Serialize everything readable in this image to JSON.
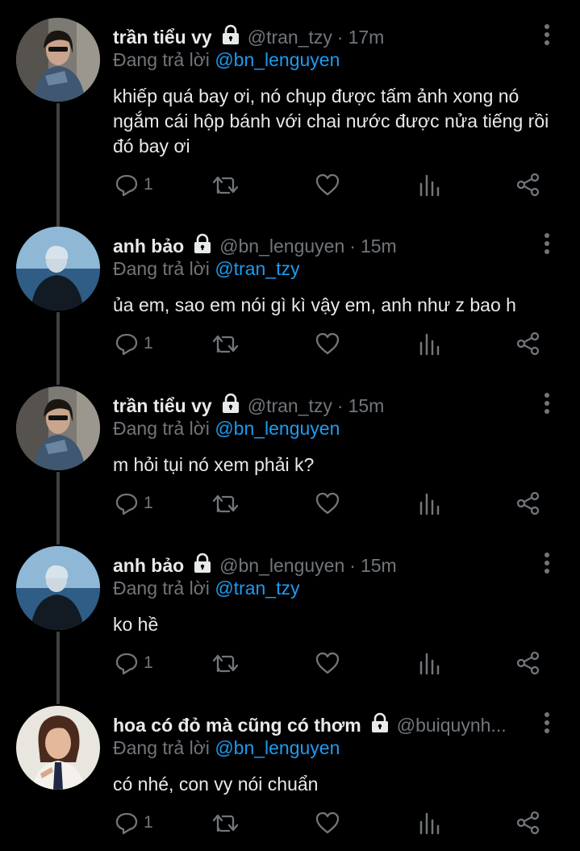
{
  "tweets": [
    {
      "name": "trần tiểu vy",
      "handle": "@tran_tzy",
      "time": "17m",
      "reply_prefix": "Đang trả lời",
      "reply_to": "@bn_lenguyen",
      "text": "khiếp quá bay ơi, nó chụp được tấm ảnh xong nó ngắm cái hộp bánh với chai nước được nửa tiếng rồi đó bay ơi",
      "reply_count": "1"
    },
    {
      "name": "anh bảo",
      "handle": "@bn_lenguyen",
      "time": "15m",
      "reply_prefix": "Đang trả lời",
      "reply_to": "@tran_tzy",
      "text": "ủa em, sao em nói gì kì vậy em, anh như z bao h",
      "reply_count": "1"
    },
    {
      "name": "trần tiểu vy",
      "handle": "@tran_tzy",
      "time": "15m",
      "reply_prefix": "Đang trả lời",
      "reply_to": "@bn_lenguyen",
      "text": "m hỏi tụi nó xem phải k?",
      "reply_count": "1"
    },
    {
      "name": "anh bảo",
      "handle": "@bn_lenguyen",
      "time": "15m",
      "reply_prefix": "Đang trả lời",
      "reply_to": "@tran_tzy",
      "text": "ko hề",
      "reply_count": "1"
    },
    {
      "name": "hoa có đỏ mà cũng có thơm",
      "handle": "@buiquynh...",
      "time": "",
      "reply_prefix": "Đang trả lời",
      "reply_to": "@bn_lenguyen",
      "text": "có nhé, con vy nói chuẩn",
      "reply_count": "1"
    }
  ],
  "colors": {
    "background": "#000000",
    "text": "#e7e9ea",
    "muted": "#71767b",
    "accent": "#1d9bf0",
    "thread_line": "#3e4144"
  },
  "icons": [
    "lock-icon",
    "more-vertical-icon",
    "reply-icon",
    "retweet-icon",
    "like-icon",
    "analytics-icon",
    "share-icon"
  ]
}
